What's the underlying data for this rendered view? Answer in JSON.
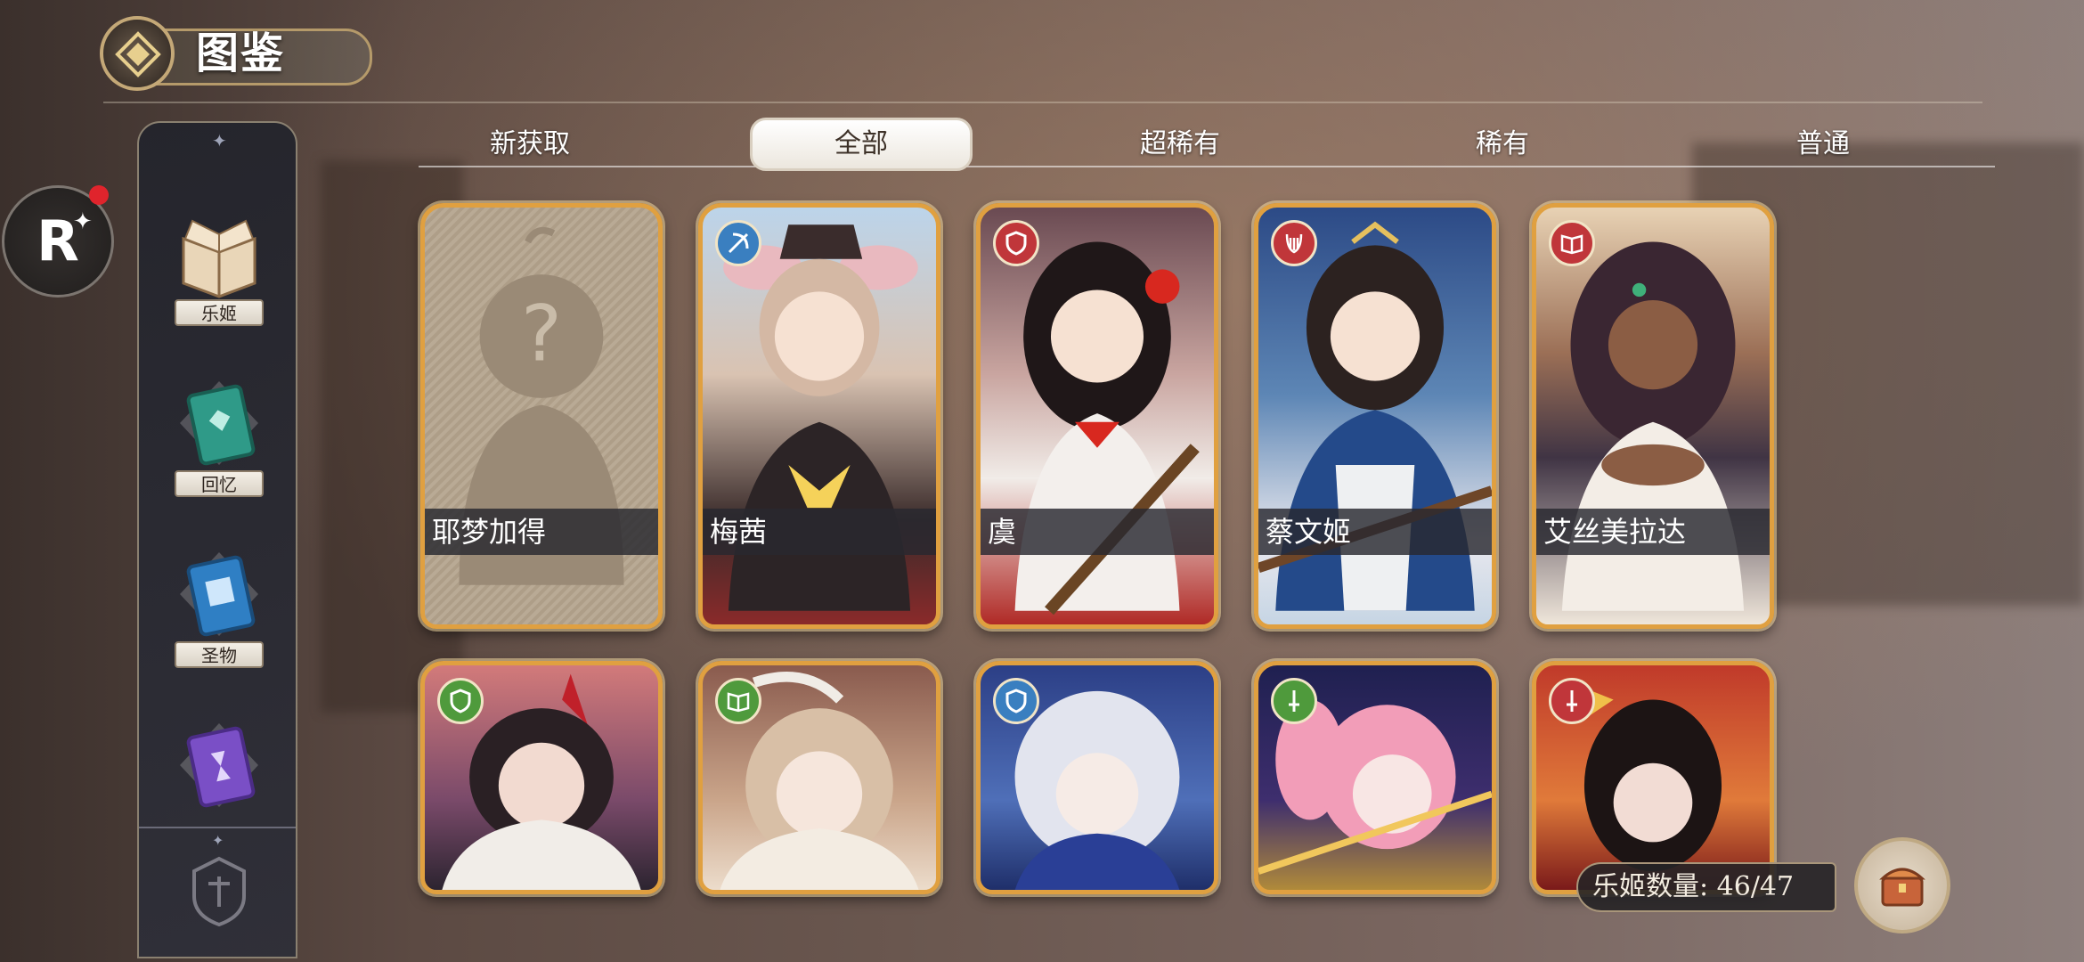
{
  "header": {
    "title": "图鉴"
  },
  "tabs": [
    {
      "label": "新获取",
      "active": false
    },
    {
      "label": "全部",
      "active": true
    },
    {
      "label": "超稀有",
      "active": false
    },
    {
      "label": "稀有",
      "active": false
    },
    {
      "label": "普通",
      "active": false
    }
  ],
  "sidebar": {
    "items": [
      {
        "label": "乐姬",
        "icon": "open-book-icon",
        "selected": true
      },
      {
        "label": "回忆",
        "icon": "green-book-icon"
      },
      {
        "label": "圣物",
        "icon": "blue-book-icon"
      },
      {
        "label": "",
        "icon": "purple-book-icon"
      }
    ]
  },
  "r_button": {
    "label": "R",
    "notification": true
  },
  "cards": [
    {
      "name": "耶梦加得",
      "locked": true,
      "class_icon": ""
    },
    {
      "name": "梅茜",
      "locked": false,
      "class_icon": "bow-icon",
      "badge_color": "#3a7fc0"
    },
    {
      "name": "虞",
      "locked": false,
      "class_icon": "shield-icon",
      "badge_color": "#c0363a"
    },
    {
      "name": "蔡文姬",
      "locked": false,
      "class_icon": "lyre-icon",
      "badge_color": "#c0363a"
    },
    {
      "name": "艾丝美拉达",
      "locked": false,
      "class_icon": "book-icon",
      "badge_color": "#c0363a"
    },
    {
      "name": "",
      "locked": false,
      "class_icon": "shield-icon",
      "badge_color": "#4f9a3c"
    },
    {
      "name": "",
      "locked": false,
      "class_icon": "book-icon",
      "badge_color": "#4f9a3c"
    },
    {
      "name": "",
      "locked": false,
      "class_icon": "shield-icon",
      "badge_color": "#3a7fc0"
    },
    {
      "name": "",
      "locked": false,
      "class_icon": "sword-icon",
      "badge_color": "#4f9a3c"
    },
    {
      "name": "",
      "locked": false,
      "class_icon": "sword-icon",
      "badge_color": "#c0363a"
    }
  ],
  "footer": {
    "count_label": "乐姬数量: 46/47"
  },
  "colors": {
    "card_border": "#e0a040",
    "accent_red": "#e0242c"
  }
}
